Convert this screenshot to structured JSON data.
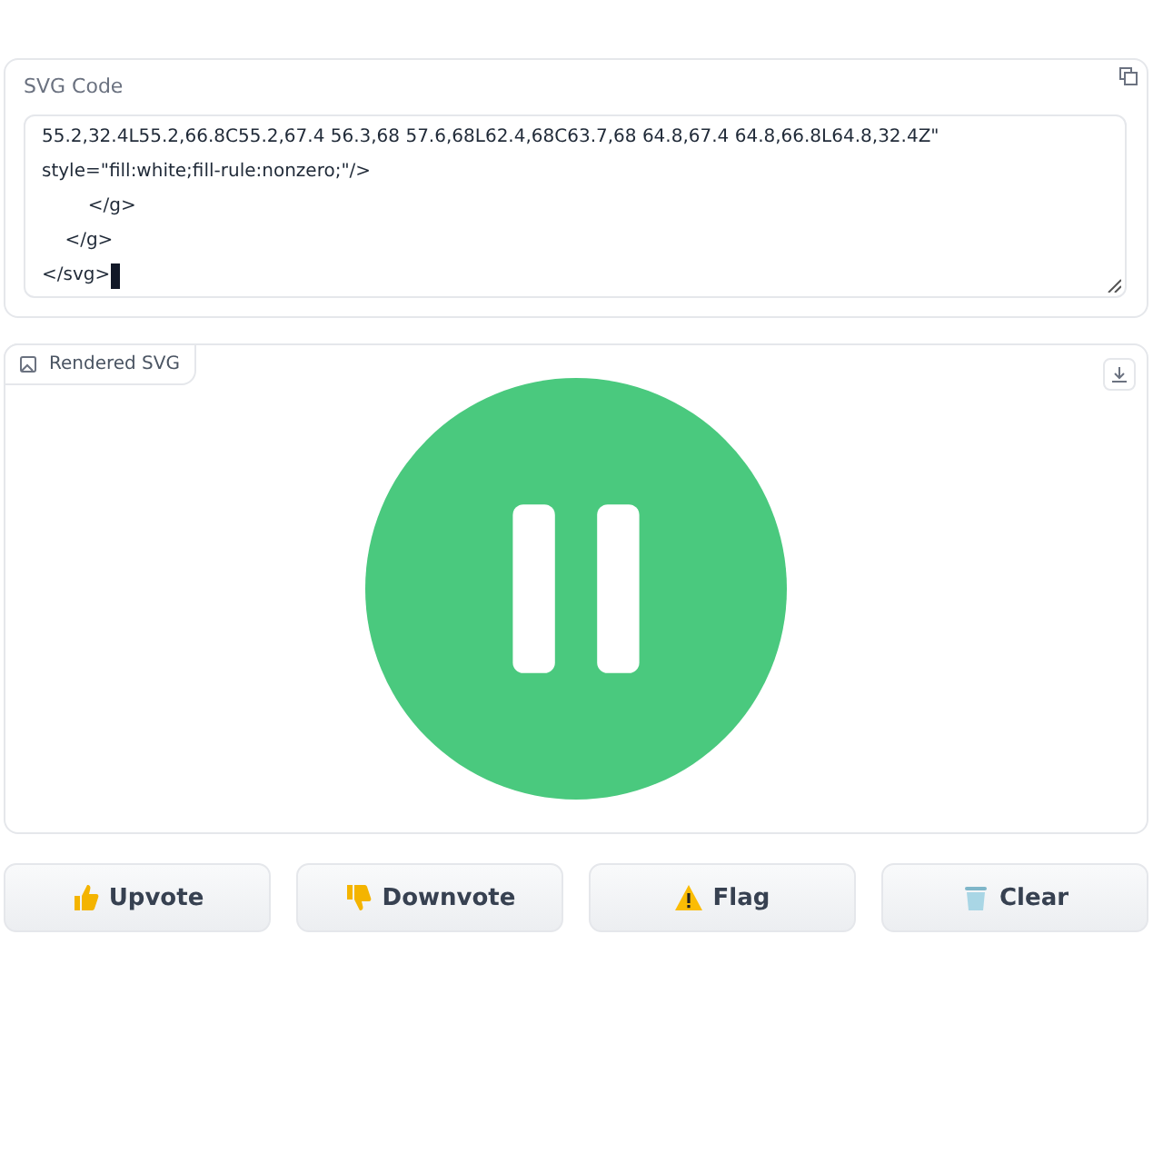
{
  "code_panel": {
    "label": "SVG Code",
    "lines": [
      {
        "text": "55.2,32.4L55.2,66.8C55.2,67.4 56.3,68 57.6,68L62.4,68C63.7,68 64.8,67.4 64.8,66.8L64.8,32.4Z\""
      },
      {
        "text": "style=\"fill:white;fill-rule:nonzero;\"/>"
      },
      {
        "text": "        </g>"
      },
      {
        "text": "    </g>"
      },
      {
        "text": "</svg>",
        "cursor": true
      }
    ]
  },
  "render_panel": {
    "label": "Rendered SVG"
  },
  "buttons": [
    {
      "kind": "up",
      "label": "Upvote"
    },
    {
      "kind": "down",
      "label": "Downvote"
    },
    {
      "kind": "flag",
      "label": "Flag"
    },
    {
      "kind": "clear",
      "label": "Clear"
    }
  ]
}
